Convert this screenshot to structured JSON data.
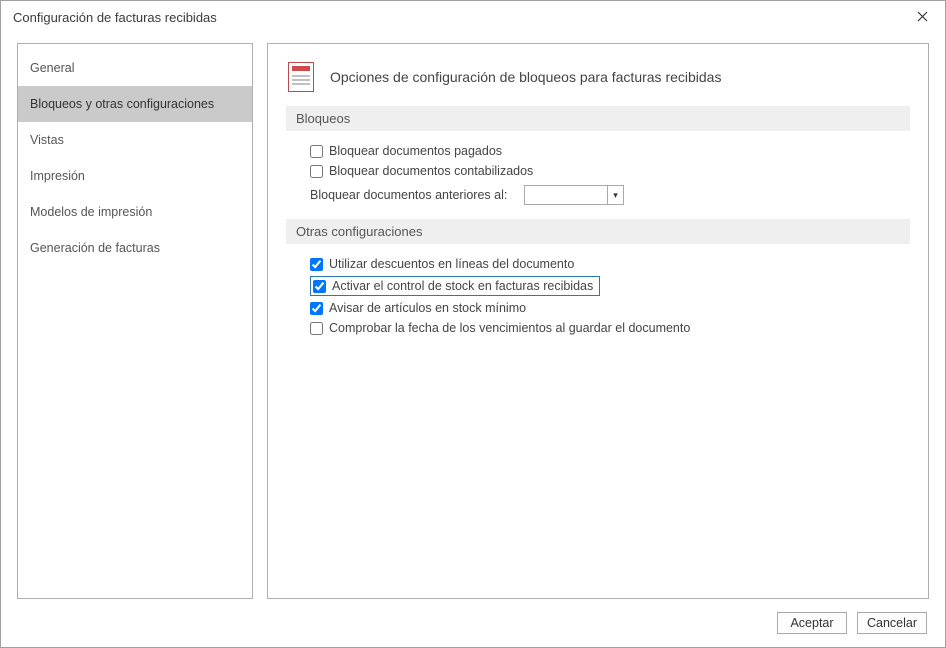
{
  "window": {
    "title": "Configuración de facturas recibidas"
  },
  "sidebar": {
    "items": [
      {
        "label": "General"
      },
      {
        "label": "Bloqueos y otras configuraciones"
      },
      {
        "label": "Vistas"
      },
      {
        "label": "Impresión"
      },
      {
        "label": "Modelos de impresión"
      },
      {
        "label": "Generación de facturas"
      }
    ],
    "selected_index": 1
  },
  "main": {
    "heading": "Opciones de configuración de bloqueos para facturas recibidas",
    "sections": {
      "bloqueos": {
        "title": "Bloqueos",
        "chk_docs_pagados": {
          "label": "Bloquear documentos pagados",
          "checked": false
        },
        "chk_docs_contabilizados": {
          "label": "Bloquear documentos contabilizados",
          "checked": false
        },
        "date_row": {
          "label": "Bloquear documentos anteriores al:",
          "value": ""
        }
      },
      "otras": {
        "title": "Otras configuraciones",
        "chk_descuentos": {
          "label": "Utilizar descuentos en líneas del documento",
          "checked": true
        },
        "chk_control_stock": {
          "label": "Activar el control de stock en facturas recibidas",
          "checked": true,
          "highlight": true
        },
        "chk_stock_min": {
          "label": "Avisar de artículos en stock mínimo",
          "checked": true
        },
        "chk_fechas_venc": {
          "label": "Comprobar la fecha de los vencimientos al guardar el documento",
          "checked": false
        }
      }
    }
  },
  "footer": {
    "accept": "Aceptar",
    "cancel": "Cancelar"
  }
}
